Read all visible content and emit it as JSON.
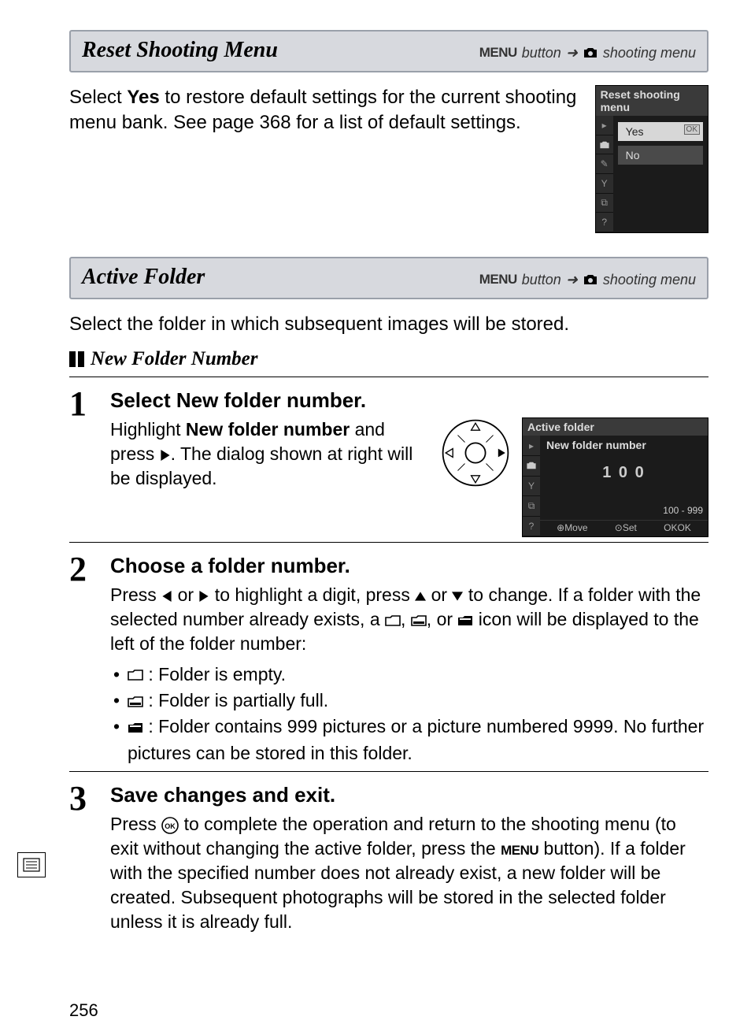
{
  "page_number": "256",
  "sections": {
    "reset": {
      "title": "Reset Shooting Menu",
      "nav_menu": "MENU",
      "nav_button": "button",
      "nav_arrow": "➜",
      "nav_dest": "shooting menu",
      "body_pre": "Select ",
      "body_bold": "Yes",
      "body_post": " to restore default settings for the current shooting menu bank.  See page 368 for a list of default settings.",
      "shot_title": "Reset shooting menu",
      "opt_yes": "Yes",
      "opt_no": "No"
    },
    "active": {
      "title": "Active Folder",
      "nav_menu": "MENU",
      "nav_button": "button",
      "nav_arrow": "➜",
      "nav_dest": "shooting menu",
      "intro": "Select the folder in which subsequent images will be stored.",
      "subhead": "New Folder Number"
    }
  },
  "steps": {
    "s1": {
      "num": "1",
      "title": "Select New folder number.",
      "text_pre": "Highlight ",
      "text_bold": "New folder number",
      "text_mid": " and press ",
      "text_post": ".  The dialog shown at right will be displayed.",
      "shot_title": "Active folder",
      "shot_row": "New folder number",
      "shot_center": "1 0 0",
      "shot_range": "100 - 999",
      "shot_foot_move": "Move",
      "shot_foot_set": "Set",
      "shot_foot_ok": "OK"
    },
    "s2": {
      "num": "2",
      "title": "Choose a folder number.",
      "text_1a": "Press ",
      "text_1b": " or ",
      "text_1c": " to highlight a digit, press ",
      "text_1d": " or ",
      "text_1e": " to change.  If a folder with the selected number already exists, a ",
      "text_1f": ", ",
      "text_1g": ", or ",
      "text_1h": " icon will be displayed to the left of the folder number:",
      "b1": " : Folder is empty.",
      "b2": " : Folder is partially full.",
      "b3a": " : Folder contains 999 pictures or a picture numbered 9999.  No further pictures can be stored in this folder."
    },
    "s3": {
      "num": "3",
      "title": "Save changes and exit.",
      "text_a": "Press ",
      "text_b": " to complete the operation and return to the shooting menu (to exit without changing the active folder, press the ",
      "menu_word": "MENU",
      "text_c": " button). If a folder with the specified number does not already exist, a new folder will be created. Subsequent photographs will be stored in the selected folder unless it is already full."
    }
  }
}
